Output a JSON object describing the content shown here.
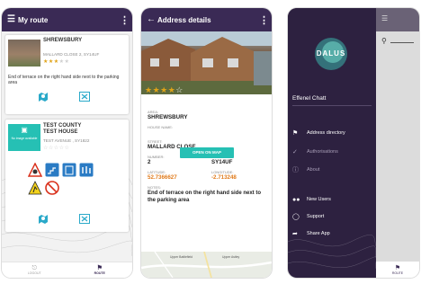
{
  "colors": {
    "header": "#3a2a55",
    "drawer": "#2d2140",
    "accent_teal": "#26c0b4",
    "star": "#e0a317",
    "coord_orange": "#e07b1c"
  },
  "screen1": {
    "title": "My route",
    "cards": [
      {
        "name": "SHREWSBURY",
        "address": "MALLARD CLOSE 2, SY14UF",
        "rating": 3,
        "note": "End of terrace on the right hand side next to the parking area"
      },
      {
        "name": "TEST COUNTY",
        "name2": "TEST HOUSE",
        "address": "TEST AVENUE , SY1822",
        "no_image": "No image available",
        "rating": 0
      }
    ],
    "tabs": [
      "LOGOUT",
      "ROUTE"
    ]
  },
  "screen2": {
    "title": "Address details",
    "rating": 3.5,
    "fields": {
      "area_label": "AREA:",
      "area_value": "SHREWSBURY",
      "house_label": "HOUSE NAME:",
      "street_label": "STREET:",
      "street_value": "MALLARD CLOSE",
      "number_label": "NUMBER:",
      "number_value": "2",
      "postcode_label": "POSTCODE:",
      "postcode_value": "SY14UF",
      "lat_label": "LATITUDE:",
      "lat_value": "52.7366627",
      "lng_label": "LONGITUDE:",
      "lng_value": "-2.713248",
      "notes_label": "NOTES:",
      "notes_value": "End of terrace on the right hand side next to the parking area"
    },
    "open_map": "OPEN ON MAP",
    "map_labels": [
      "Upper Battlefield",
      "Upper Astley"
    ]
  },
  "screen3": {
    "logo": "DALUS",
    "user": "Effenel Chatt",
    "menu": [
      {
        "label": "Address directory",
        "icon": "signpost-icon",
        "active": true
      },
      {
        "label": "Authorisations",
        "icon": "check-list-icon",
        "active": false
      },
      {
        "label": "About",
        "icon": "info-icon",
        "active": false
      },
      {
        "label": "New Users",
        "icon": "users-icon",
        "active": true
      },
      {
        "label": "Support",
        "icon": "lifebuoy-icon",
        "active": true
      },
      {
        "label": "Share App",
        "icon": "share-icon",
        "active": true
      }
    ],
    "tab": "ROUTE"
  }
}
